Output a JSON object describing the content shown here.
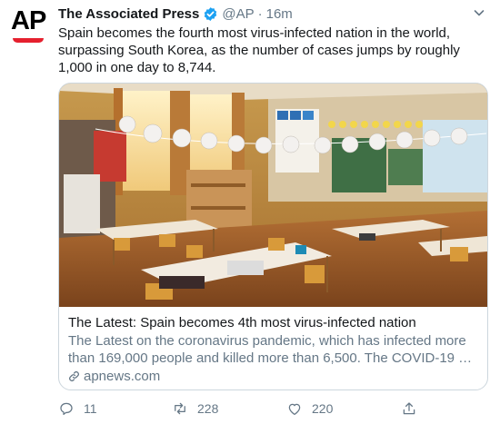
{
  "tweet": {
    "author_name": "The Associated Press",
    "handle": "@AP",
    "separator": "·",
    "time": "16m",
    "avatar_text": "AP",
    "text": "Spain becomes the fourth most virus-infected nation in the world, surpassing South Korea, as the number of cases jumps by roughly 1,000 in one day to 8,744."
  },
  "card": {
    "title": "The Latest: Spain becomes 4th most virus-infected nation",
    "description": "The Latest on the coronavirus pandemic, which has infected more than 169,000 people and killed more than 6,500. The COVID-19 …",
    "domain": "apnews.com",
    "image": "photo of an empty classroom with children's drawings hanging on a line"
  },
  "actions": {
    "reply_count": "11",
    "retweet_count": "228",
    "like_count": "220"
  },
  "colors": {
    "text": "#14171a",
    "secondary": "#657786",
    "verified": "#1da1f2",
    "ap_red": "#e5202e",
    "border": "#ccd6dd"
  },
  "icons": [
    "verified-badge-icon",
    "chevron-down-icon",
    "link-icon",
    "reply-icon",
    "retweet-icon",
    "like-icon",
    "share-icon"
  ]
}
